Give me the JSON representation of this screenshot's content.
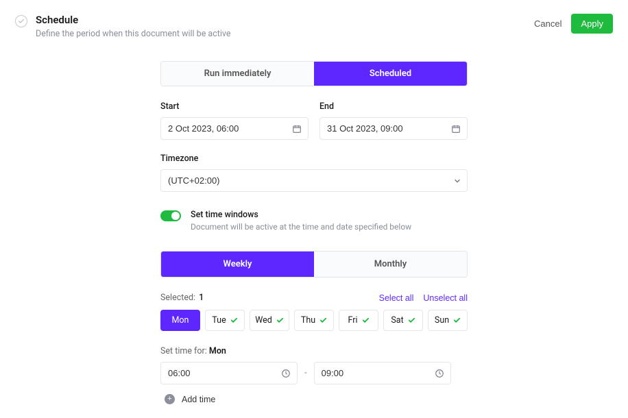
{
  "header": {
    "title": "Schedule",
    "subtitle": "Define the period when this document will be active",
    "cancel": "Cancel",
    "apply": "Apply"
  },
  "modeTabs": {
    "run": "Run immediately",
    "scheduled": "Scheduled"
  },
  "labels": {
    "start": "Start",
    "end": "End",
    "timezone": "Timezone"
  },
  "fields": {
    "start": "2 Oct 2023, 06:00",
    "end": "31 Oct 2023, 09:00",
    "timezone": "(UTC+02:00)"
  },
  "toggle": {
    "label": "Set time windows",
    "description": "Document will be active at the time and date specified below"
  },
  "periodTabs": {
    "weekly": "Weekly",
    "monthly": "Monthly"
  },
  "selection": {
    "label": "Selected:",
    "count": "1",
    "selectAll": "Select all",
    "unselectAll": "Unselect all"
  },
  "days": [
    {
      "label": "Mon",
      "active": true
    },
    {
      "label": "Tue",
      "active": false
    },
    {
      "label": "Wed",
      "active": false
    },
    {
      "label": "Thu",
      "active": false
    },
    {
      "label": "Fri",
      "active": false
    },
    {
      "label": "Sat",
      "active": false
    },
    {
      "label": "Sun",
      "active": false
    }
  ],
  "setTimeFor": {
    "prefix": "Set time for:",
    "day": "Mon"
  },
  "timeWindow": {
    "from": "06:00",
    "to": "09:00"
  },
  "addTime": "Add time"
}
